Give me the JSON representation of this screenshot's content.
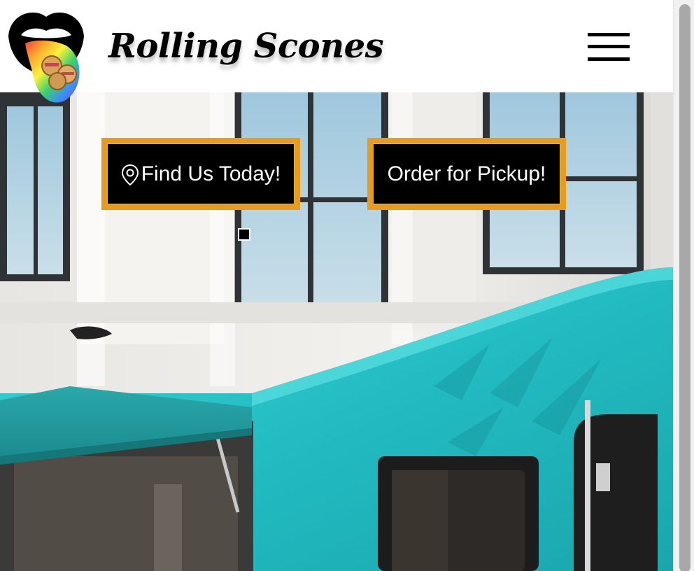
{
  "brand": {
    "name": "Rolling Scones",
    "logo_icon": "tongue-logo-icon"
  },
  "header": {
    "menu_icon": "hamburger-menu-icon"
  },
  "cta": {
    "find_label": "Find Us Today!",
    "find_icon": "map-pin-icon",
    "order_label": "Order for Pickup!"
  },
  "hero": {
    "image": "teal food truck in front of building"
  },
  "colors": {
    "cta_border": "#e79c1e",
    "cta_bg": "#000000",
    "truck_teal": "#27c3c8"
  }
}
